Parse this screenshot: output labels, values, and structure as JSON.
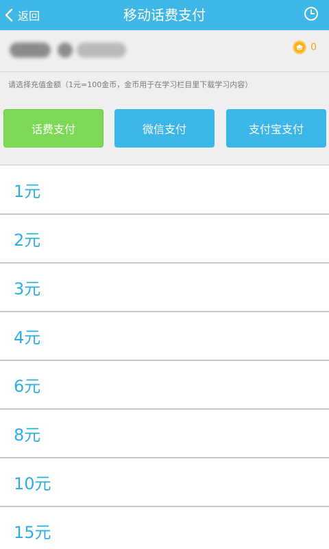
{
  "header": {
    "back_label": "返回",
    "title": "移动话费支付"
  },
  "account": {
    "coin_count": "0"
  },
  "notice": "请选择充值金额（1元=100金币，金币用于在学习栏目里下载学习内容）",
  "payment_methods": [
    {
      "label": "话费支付",
      "selected": true,
      "color": "#7ed957"
    },
    {
      "label": "微信支付",
      "selected": false,
      "color": "#3bb6e8"
    },
    {
      "label": "支付宝支付",
      "selected": false,
      "color": "#3bb6e8"
    }
  ],
  "amounts": [
    "1元",
    "2元",
    "3元",
    "4元",
    "6元",
    "8元",
    "10元",
    "15元"
  ],
  "colors": {
    "header_bg": "#3fb7e6",
    "amount_text": "#2eaee0",
    "coin": "#f6b31b"
  },
  "icons": {
    "back": "chevron-left-icon",
    "history": "clock-icon",
    "coin": "coin-icon"
  }
}
